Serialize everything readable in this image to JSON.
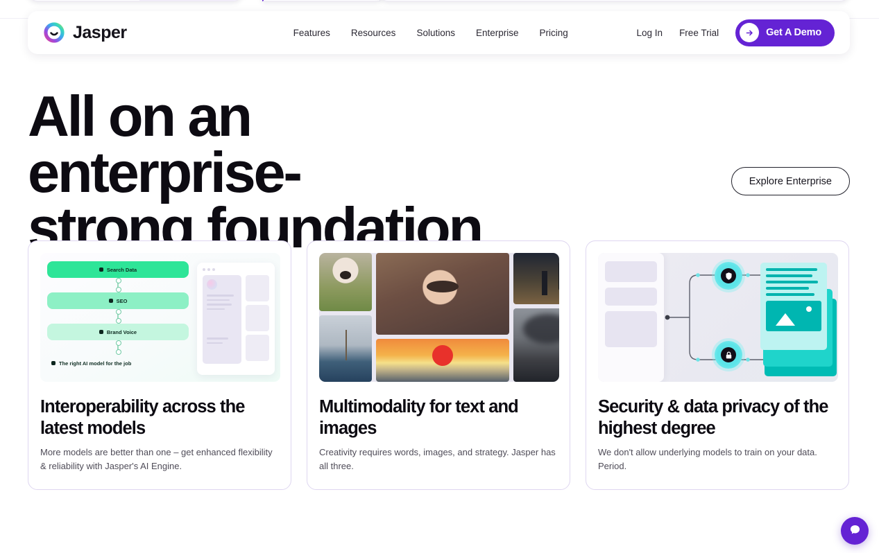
{
  "top_strip": {
    "present": true
  },
  "nav": {
    "brand": "Jasper",
    "logo_icon": "jasper-smile-ring-logo",
    "links": [
      {
        "label": "Features"
      },
      {
        "label": "Resources"
      },
      {
        "label": "Solutions"
      },
      {
        "label": "Enterprise"
      },
      {
        "label": "Pricing"
      }
    ],
    "actions": [
      {
        "label": "Log In"
      },
      {
        "label": "Free Trial"
      }
    ],
    "cta": {
      "label": "Get A Demo",
      "icon": "arrow-right-icon",
      "bg": "#6423d4",
      "fg": "#ffffff"
    }
  },
  "hero": {
    "title_line1": "All on an enterprise-",
    "title_line2": "strong foundation",
    "button": {
      "label": "Explore Enterprise"
    }
  },
  "cards": [
    {
      "media_icon": "model-routing-flow-illustration",
      "title": "Interoperability across the latest models",
      "desc": "More models are better than one – get enhanced flexibility & reliability with Jasper's AI Engine.",
      "pills": [
        {
          "label": "Search Data",
          "color": "#2ee598"
        },
        {
          "label": "SEO",
          "color": "#8df0c5"
        },
        {
          "label": "Brand Voice",
          "color": "#c4f6df"
        },
        {
          "label": "The right AI model for the job",
          "color": "transparent"
        }
      ]
    },
    {
      "media_icon": "ai-image-mosaic-illustration",
      "title": "Multimodality for text and images",
      "desc": "Creativity requires words, images, and strategy. Jasper has all three.",
      "tiles": [
        "dog-photo",
        "sailing-ship-photo",
        "geisha-portrait-photo",
        "sunset-ocean-photo",
        "two-figures-photo",
        "storm-landscape-photo",
        "blue-abstract-photo",
        "dark-abstract-photo"
      ]
    },
    {
      "media_icon": "security-data-flow-illustration",
      "title": "Security & data privacy of the highest degree",
      "desc": "We don't allow underlying models to train on your data. Period.",
      "nodes": [
        "shield-icon",
        "lock-icon"
      ]
    }
  ],
  "chat_widget": {
    "icon": "chat-bubble-icon",
    "bg": "#6423d4"
  },
  "colors": {
    "accent_purple": "#6423d4",
    "card_border": "#ded6f0",
    "text_dark": "#0d0b12",
    "text_muted": "#4f4c58",
    "green": "#2ee598",
    "teal": "#1fd4cb"
  }
}
